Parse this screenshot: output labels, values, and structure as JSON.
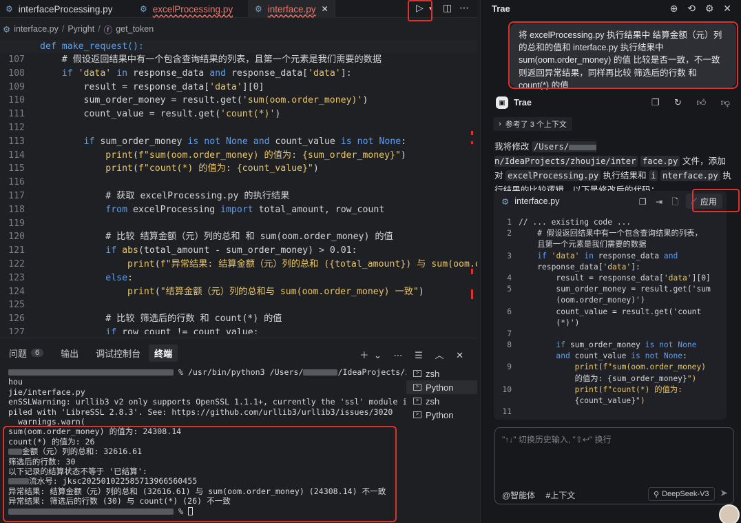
{
  "editor": {
    "tabs": [
      {
        "label": "interfaceProcessing.py"
      },
      {
        "label": "excelProcessing.py"
      },
      {
        "label": "interface.py"
      }
    ],
    "breadcrumb": {
      "file": "interface.py",
      "lib": "Pyright",
      "symbol": "get_token"
    },
    "sticky": "def make_request():",
    "lines": [
      {
        "n": "107",
        "t": "    # 假设返回结果中有一个包含查询结果的列表，且第一个元素是我们需要的数据"
      },
      {
        "n": "108",
        "t": "    if 'data' in response_data and response_data['data']:"
      },
      {
        "n": "109",
        "t": "        result = response_data['data'][0]"
      },
      {
        "n": "110",
        "t": "        sum_order_money = result.get('sum(oom.order_money)')"
      },
      {
        "n": "111",
        "t": "        count_value = result.get('count(*)')"
      },
      {
        "n": "112",
        "t": ""
      },
      {
        "n": "113",
        "t": "        if sum_order_money is not None and count_value is not None:"
      },
      {
        "n": "114",
        "t": "            print(f\"sum(oom.order_money) 的值为: {sum_order_money}\")"
      },
      {
        "n": "115",
        "t": "            print(f\"count(*) 的值为: {count_value}\")"
      },
      {
        "n": "116",
        "t": ""
      },
      {
        "n": "117",
        "t": "            # 获取 excelProcessing.py 的执行结果"
      },
      {
        "n": "118",
        "t": "            from excelProcessing import total_amount, row_count"
      },
      {
        "n": "119",
        "t": ""
      },
      {
        "n": "120",
        "t": "            # 比较 结算金额（元）列的总和 和 sum(oom.order_money) 的值"
      },
      {
        "n": "121",
        "t": "            if abs(total_amount - sum_order_money) > 0.01:"
      },
      {
        "n": "122",
        "t": "                print(f\"异常结果: 结算金额（元）列的总和 ({total_amount}) 与 sum(oom.order_"
      },
      {
        "n": "123",
        "t": "            else:"
      },
      {
        "n": "124",
        "t": "                print(\"结算金额（元）列的总和与 sum(oom.order_money) 一致\")"
      },
      {
        "n": "125",
        "t": ""
      },
      {
        "n": "126",
        "t": "            # 比较 筛选后的行数 和 count(*) 的值"
      },
      {
        "n": "127",
        "t": "            if row_count != count_value:"
      }
    ]
  },
  "panel": {
    "tabs": [
      {
        "label": "问题",
        "badge": "6"
      },
      {
        "label": "输出"
      },
      {
        "label": "调试控制台"
      },
      {
        "label": "终端"
      }
    ],
    "terminal": [
      "% /usr/bin/python3 /Users/",
      "/IdeaProjects/z",
      "hou",
      "jie/interface.py",
      "enSSLWarning: urllib3 v2 only supports OpenSSL 1.1.1+, currently the 'ssl' module is com",
      "piled with 'LibreSSL 2.8.3'. See: https://github.com/urllib3/urllib3/issues/3020",
      "  warnings.warn(",
      "sum(oom.order_money) 的值为: 24308.14",
      "count(*) 的值为: 26",
      "金额（元）列的总和: 32616.61",
      "筛选后的行数: 30",
      "以下记录的结算状态不等于 '已结算':",
      "流水号: jksc20250102258571396656045​5",
      "异常结果: 结算金额（元）列的总和 (32616.61) 与 sum(oom.order_money) (24308.14) 不一致",
      "异常结果: 筛选后的行数 (30) 与 count(*) (26) 不一致",
      "%"
    ],
    "shells": [
      "zsh",
      "Python",
      "zsh",
      "Python"
    ]
  },
  "trae": {
    "title": "Trae",
    "user_message": "将 excelProcessing.py 执行结果中 结算金额（元）列的总和的值和 interface.py 执行结果中 sum(oom.order_money) 的值 比较是否一致，不一致则返回异常结果，同样再比较 筛选后的行数 和 count(*) 的值",
    "assistant_name": "Trae",
    "ref_chip": "参考了 3 个上下文",
    "reply_1": "我将修改",
    "reply_path": "/Users/",
    "reply_path2": "n/IdeaProjects/zhoujie/inter",
    "reply_path3": "face.py",
    "reply_2": "文件，添加对",
    "reply_code1": "excelProcessing.py",
    "reply_3": "执行结果和",
    "reply_code2": "i",
    "reply_code3": "nterface.py",
    "reply_4": "执行结果的比较逻辑。以下是修改后的代码：",
    "code_file": "interface.py",
    "apply_label": "应用",
    "code_lines": [
      {
        "n": "1",
        "t": "// ... existing code ..."
      },
      {
        "n": "2",
        "t": "    # 假设返回结果中有一个包含查询结果的列表，"
      },
      {
        "n": "",
        "t": "    且第一个元素是我们需要的数据"
      },
      {
        "n": "3",
        "t": "    if 'data' in response_data and"
      },
      {
        "n": "",
        "t": "    response_data['data']:"
      },
      {
        "n": "4",
        "t": "        result = response_data['data'][0]"
      },
      {
        "n": "5",
        "t": "        sum_order_money = result.get('sum"
      },
      {
        "n": "",
        "t": "        (oom.order_money)')"
      },
      {
        "n": "6",
        "t": "        count_value = result.get('count"
      },
      {
        "n": "",
        "t": "        (*)')"
      },
      {
        "n": "7",
        "t": ""
      },
      {
        "n": "8",
        "t": "        if sum_order_money is not None"
      },
      {
        "n": "",
        "t": "        and count_value is not None:"
      },
      {
        "n": "9",
        "t": "            print(f\"sum(oom.order_money)"
      },
      {
        "n": "",
        "t": "            的值为: {sum_order_money}\")"
      },
      {
        "n": "10",
        "t": "            print(f\"count(*) 的值为:"
      },
      {
        "n": "",
        "t": "            {count_value}\")"
      },
      {
        "n": "11",
        "t": ""
      }
    ],
    "input_placeholder": "\"↑↓\" 切换历史输入, \"⇧↩\" 换行",
    "agent_label": "@智能体",
    "context_label": "#上下文",
    "model": "DeepSeek-V3"
  }
}
